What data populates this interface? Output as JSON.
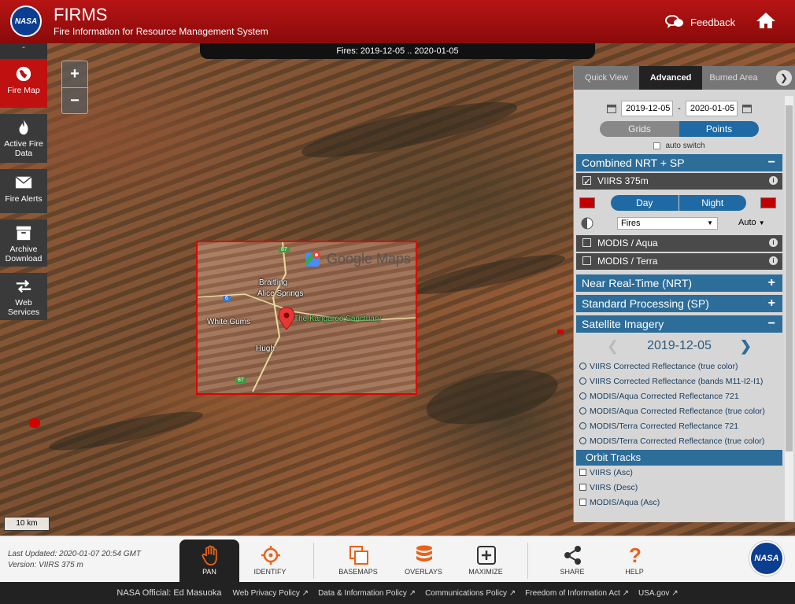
{
  "header": {
    "logo_text": "NASA",
    "title": "FIRMS",
    "subtitle": "Fire Information for Resource Management System",
    "feedback_label": "Feedback"
  },
  "map": {
    "date_range_label": "Fires: 2019-12-05 .. 2020-01-05",
    "scale_label": "10 km",
    "google_maps": {
      "logo_text": "Google Maps",
      "places": {
        "braitling": "Braitling",
        "alice_springs": "Alice Springs",
        "white_gums": "White Gums",
        "kangaroo_sanctuary": "The Kangaroo Sanctuary",
        "hugh": "Hugh"
      },
      "roads": [
        "87",
        "6",
        "87"
      ]
    }
  },
  "left_nav": {
    "items": [
      {
        "label": "Fire Map",
        "icon": "globe-icon"
      },
      {
        "label": "Active Fire Data",
        "icon": "flame-icon"
      },
      {
        "label": "Fire Alerts",
        "icon": "envelope-icon"
      },
      {
        "label": "Archive Download",
        "icon": "archive-box-icon"
      },
      {
        "label": "Web Services",
        "icon": "swap-arrows-icon"
      }
    ]
  },
  "zoom": {
    "in": "+",
    "out": "−"
  },
  "panel": {
    "tabs": [
      "Quick View",
      "Advanced",
      "Burned Area"
    ],
    "active_tab": "Advanced",
    "start_date": "2019-12-05",
    "date_separator": "-",
    "end_date": "2020-01-05",
    "grids_label": "Grids",
    "points_label": "Points",
    "auto_switch_label": "auto switch",
    "combined": {
      "title": "Combined NRT + SP",
      "sign": "−",
      "viirs_label": "VIIRS 375m",
      "day_label": "Day",
      "night_label": "Night",
      "fires_option": "Fires",
      "auto_label": "Auto",
      "modis_aqua": "MODIS / Aqua",
      "modis_terra": "MODIS / Terra",
      "accent_color": "#c00000"
    },
    "nrt_title": "Near Real-Time (NRT)",
    "sp_title": "Standard Processing (SP)",
    "plus": "+",
    "imagery": {
      "title": "Satellite Imagery",
      "sign": "−",
      "date": "2019-12-05",
      "options": [
        "VIIRS Corrected Reflectance (true color)",
        "VIIRS Corrected Reflectance (bands M11-I2-I1)",
        "MODIS/Aqua Corrected Reflectance 721",
        "MODIS/Aqua Corrected Reflectance (true color)",
        "MODIS/Terra Corrected Reflectance 721",
        "MODIS/Terra Corrected Reflectance (true color)"
      ]
    },
    "orbit": {
      "title": "Orbit Tracks",
      "items": [
        "VIIRS (Asc)",
        "VIIRS (Desc)",
        "MODIS/Aqua (Asc)"
      ]
    }
  },
  "toolbar": {
    "last_updated": "Last Updated: 2020-01-07 20:54 GMT",
    "version": "Version: VIIRS 375 m",
    "tools": [
      "PAN",
      "IDENTIFY",
      "BASEMAPS",
      "OVERLAYS",
      "MAXIMIZE",
      "SHARE",
      "HELP"
    ],
    "accent_color": "#e8621a"
  },
  "footer": {
    "official": "NASA Official: Ed Masuoka",
    "links": [
      "Web Privacy Policy",
      "Data & Information Policy",
      "Communications Policy",
      "Freedom of Information Act",
      "USA.gov"
    ]
  }
}
